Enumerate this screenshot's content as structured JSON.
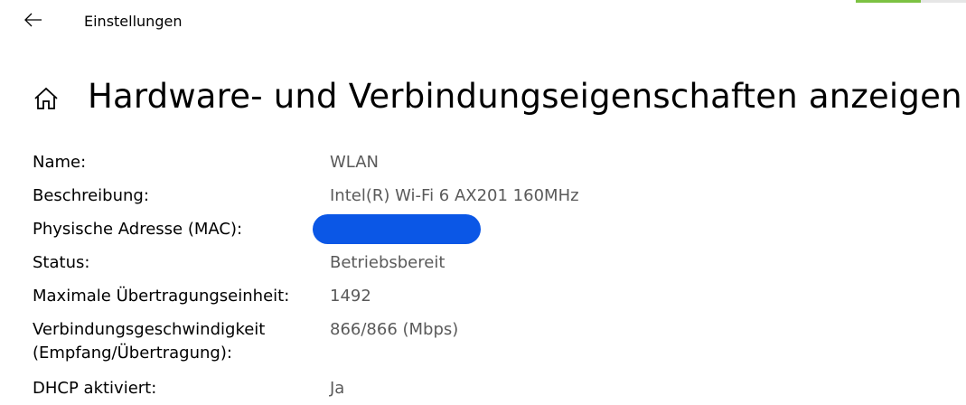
{
  "header": {
    "app_title": "Einstellungen",
    "back_icon": "arrow-left-icon"
  },
  "page": {
    "home_icon": "home-icon",
    "title": "Hardware- und Verbindungseigenschaften anzeigen"
  },
  "colors": {
    "accent_green": "#7cc242",
    "redaction_blue": "#0b57e6",
    "value_gray": "#5a5a5a"
  },
  "properties": [
    {
      "label": "Name:",
      "value": "WLAN"
    },
    {
      "label": "Beschreibung:",
      "value": "Intel(R) Wi-Fi 6 AX201 160MHz"
    },
    {
      "label": "Physische Adresse (MAC):",
      "value": ""
    },
    {
      "label": "Status:",
      "value": "Betriebsbereit"
    },
    {
      "label": "Maximale Übertragungseinheit:",
      "value": "1492"
    },
    {
      "label": "Verbindungsgeschwindigkeit (Empfang/Übertragung):",
      "value": "866/866 (Mbps)"
    },
    {
      "label": "DHCP aktiviert:",
      "value": "Ja"
    }
  ]
}
